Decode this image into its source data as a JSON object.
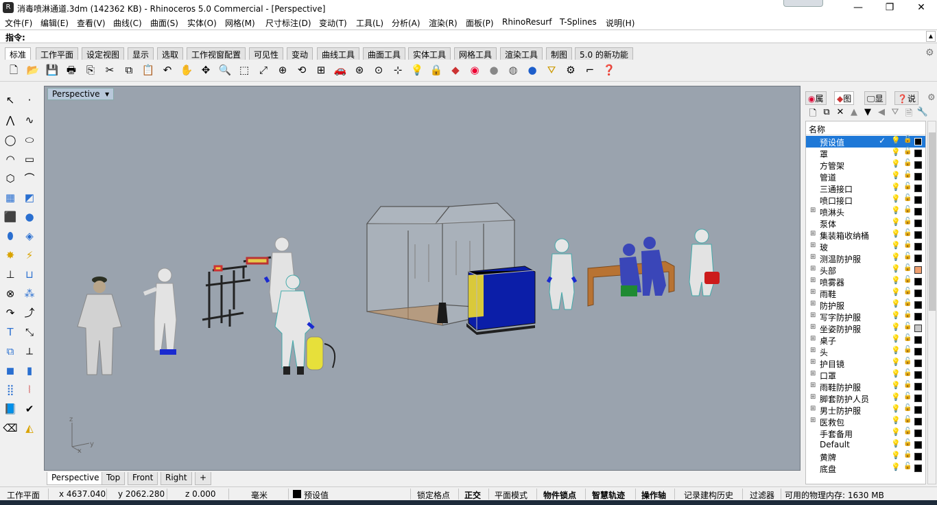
{
  "window": {
    "title": "消毒喷淋通道.3dm (142362 KB) - Rhinoceros 5.0 Commercial - [Perspective]",
    "minimize": "—",
    "restore": "❐",
    "close": "✕"
  },
  "menu": [
    "文件(F)",
    "编辑(E)",
    "查看(V)",
    "曲线(C)",
    "曲面(S)",
    "实体(O)",
    "网格(M)",
    "尺寸标注(D)",
    "变动(T)",
    "工具(L)",
    "分析(A)",
    "渲染(R)",
    "面板(P)",
    "RhinoResurf",
    "T-Splines",
    "说明(H)"
  ],
  "command": {
    "label": "指令:",
    "value": ""
  },
  "toolbar_tabs": [
    "标准",
    "工作平面",
    "设定视图",
    "显示",
    "选取",
    "工作视窗配置",
    "可见性",
    "变动",
    "曲线工具",
    "曲面工具",
    "实体工具",
    "网格工具",
    "渲染工具",
    "制图",
    "5.0 的新功能"
  ],
  "toolbar_tab_active": "标准",
  "viewport": {
    "title": "Perspective",
    "axis": {
      "x": "x",
      "y": "y",
      "z": "z"
    },
    "background": "#9aa3ae"
  },
  "viewport_tabs": [
    "Perspective",
    "Top",
    "Front",
    "Right",
    "+"
  ],
  "panel": {
    "tabs": [
      "属",
      "图",
      "显",
      "说"
    ],
    "header": "名称",
    "layers": [
      {
        "name": "预设值",
        "expand": "",
        "current": "✓",
        "color": "#000000",
        "selected": true
      },
      {
        "name": "罩",
        "expand": "",
        "color": "#000000"
      },
      {
        "name": "方管架",
        "expand": "",
        "color": "#000000"
      },
      {
        "name": "管道",
        "expand": "",
        "color": "#000000"
      },
      {
        "name": "三通接口",
        "expand": "",
        "color": "#000000"
      },
      {
        "name": "喷口接口",
        "expand": "",
        "color": "#000000"
      },
      {
        "name": "喷淋头",
        "expand": "⊞",
        "color": "#000000"
      },
      {
        "name": "泵体",
        "expand": "",
        "color": "#000000"
      },
      {
        "name": "集装箱收纳桶",
        "expand": "⊞",
        "color": "#000000"
      },
      {
        "name": "玻",
        "expand": "⊞",
        "color": "#000000"
      },
      {
        "name": "测温防护服",
        "expand": "⊞",
        "color": "#000000"
      },
      {
        "name": "头部",
        "expand": "⊞",
        "color": "#f0a070"
      },
      {
        "name": "喷雾器",
        "expand": "⊞",
        "color": "#000000"
      },
      {
        "name": "雨鞋",
        "expand": "⊞",
        "color": "#000000"
      },
      {
        "name": "防护服",
        "expand": "⊞",
        "color": "#000000"
      },
      {
        "name": "写字防护服",
        "expand": "⊞",
        "color": "#000000"
      },
      {
        "name": "坐姿防护服",
        "expand": "⊞",
        "color": "#c8c8c8"
      },
      {
        "name": "桌子",
        "expand": "⊞",
        "color": "#000000"
      },
      {
        "name": "头",
        "expand": "⊞",
        "color": "#000000"
      },
      {
        "name": "护目镜",
        "expand": "⊞",
        "color": "#000000"
      },
      {
        "name": "口罩",
        "expand": "⊞",
        "color": "#000000"
      },
      {
        "name": "雨鞋防护服",
        "expand": "⊞",
        "color": "#000000"
      },
      {
        "name": "脚套防护人员",
        "expand": "⊞",
        "color": "#000000"
      },
      {
        "name": "男士防护服",
        "expand": "⊞",
        "color": "#000000"
      },
      {
        "name": "医救包",
        "expand": "⊞",
        "color": "#000000"
      },
      {
        "name": "手套备用",
        "expand": "",
        "color": "#000000",
        "bulb_blue": true
      },
      {
        "name": "Default",
        "expand": "",
        "color": "#000000"
      },
      {
        "name": "黄牌",
        "expand": "",
        "color": "#000000"
      },
      {
        "name": "底盘",
        "expand": "",
        "color": "#000000"
      }
    ]
  },
  "status": {
    "cplane": "工作平面",
    "x": "x 4637.040",
    "y": "y 2062.280",
    "z": "z 0.000",
    "units": "毫米",
    "layer": "预设值",
    "toggles": [
      "锁定格点",
      "正交",
      "平面模式",
      "物件锁点",
      "智慧轨迹",
      "操作轴",
      "记录建构历史",
      "过滤器"
    ],
    "memory": "可用的物理内存: 1630 MB"
  }
}
